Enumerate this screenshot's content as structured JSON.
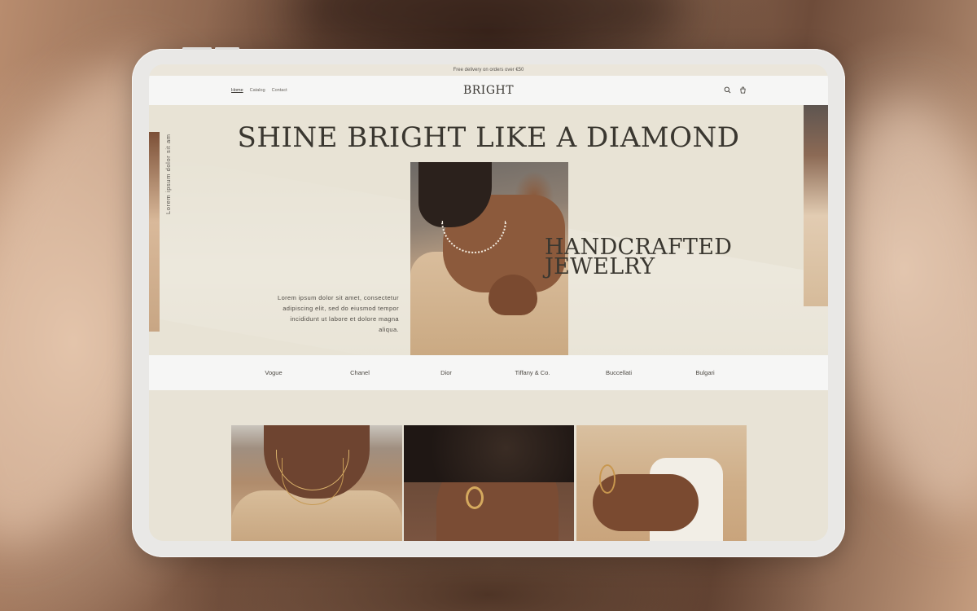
{
  "announcement": "Free delivery on orders over €50",
  "header": {
    "nav": [
      {
        "label": "Home",
        "active": true
      },
      {
        "label": "Catalog",
        "active": false
      },
      {
        "label": "Contact",
        "active": false
      }
    ],
    "logo": "BRIGHT",
    "icons": [
      "search-icon",
      "cart-icon"
    ]
  },
  "hero": {
    "title": "SHINE BRIGHT LIKE A DIAMOND",
    "side_label": "Lorem ipsum dolor sit am",
    "script_line1": "HANDCRAFTED",
    "script_line2": "JEWELRY",
    "body": "Lorem ipsum dolor sit amet, consectetur adipiscing elit, sed do eiusmod tempor incididunt ut labore et dolore magna aliqua."
  },
  "brands": [
    "Vogue",
    "Chanel",
    "Dior",
    "Tiffany & Co.",
    "Buccellati",
    "Bulgari"
  ],
  "colors": {
    "page_bg": "#e8e3d6",
    "header_bg": "#f6f6f5",
    "text_dark": "#3a3730",
    "device_frame": "#e9e8e6"
  }
}
